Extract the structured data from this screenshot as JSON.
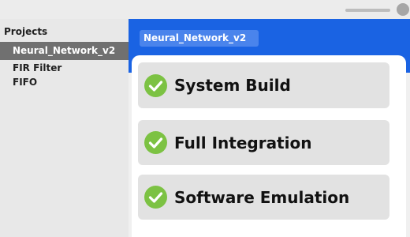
{
  "sidebar": {
    "title": "Projects",
    "items": [
      {
        "label": "Neural_Network_v2"
      },
      {
        "label": "FIR Filter"
      },
      {
        "label": "FIFO"
      }
    ]
  },
  "header": {
    "active_project": "Neural_Network_v2"
  },
  "steps": [
    {
      "label": "System Build",
      "status": "complete",
      "icon": "check-circle-icon"
    },
    {
      "label": "Full Integration",
      "status": "complete",
      "icon": "check-circle-icon"
    },
    {
      "label": "Software Emulation",
      "status": "complete",
      "icon": "check-circle-icon"
    }
  ],
  "colors": {
    "accent": "#1a63e3",
    "tab": "#4a84ec",
    "success": "#7cc243",
    "selected_item": "#707070"
  }
}
